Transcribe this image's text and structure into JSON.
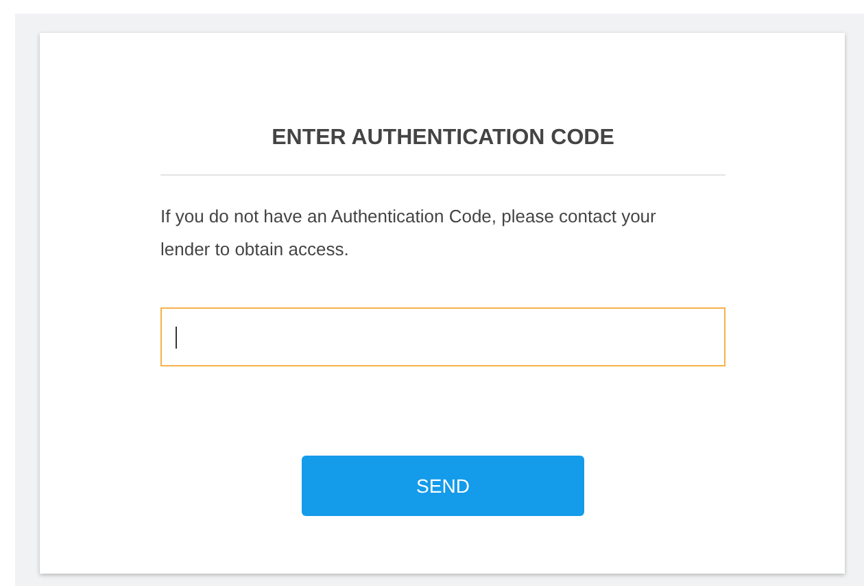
{
  "title": "ENTER AUTHENTICATION CODE",
  "message": "If you do not have an Authentication Code, please contact your lender to obtain access.",
  "code_field": {
    "focused": true
  },
  "button": {
    "label": "SEND"
  }
}
